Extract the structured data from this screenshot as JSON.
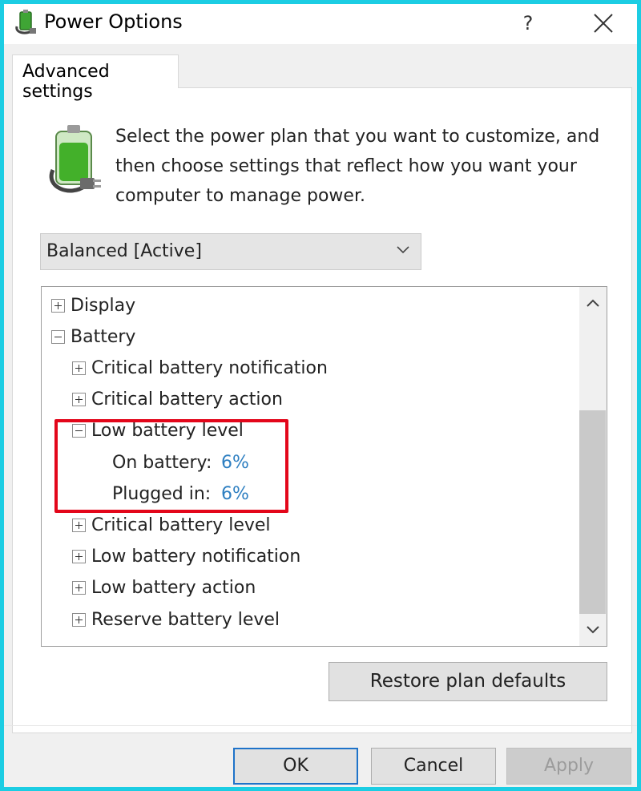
{
  "window": {
    "title": "Power Options",
    "help_label": "?",
    "icon": "power-options-icon"
  },
  "tabs": [
    {
      "label": "Advanced settings"
    }
  ],
  "description": {
    "lines": [
      "Select the power plan that you want to customize, and",
      "then choose settings that reflect how you want your",
      "computer to manage power."
    ],
    "icon": "battery-plug-icon"
  },
  "plan_select": {
    "value": "Balanced [Active]"
  },
  "tree": {
    "items": [
      {
        "label": "Display",
        "state": "collapsed"
      },
      {
        "label": "Battery",
        "state": "expanded"
      },
      {
        "label": "Critical battery notification",
        "state": "collapsed"
      },
      {
        "label": "Critical battery action",
        "state": "collapsed"
      },
      {
        "label": "Low battery level",
        "state": "expanded"
      },
      {
        "label": "On battery:",
        "value": "6%"
      },
      {
        "label": "Plugged in:",
        "value": "6%"
      },
      {
        "label": "Critical battery level",
        "state": "collapsed"
      },
      {
        "label": "Low battery notification",
        "state": "collapsed"
      },
      {
        "label": "Low battery action",
        "state": "collapsed"
      },
      {
        "label": "Reserve battery level",
        "state": "collapsed"
      }
    ]
  },
  "buttons": {
    "restore": "Restore plan defaults",
    "ok": "OK",
    "cancel": "Cancel",
    "apply": "Apply"
  },
  "colors": {
    "window_border": "#1ccde3",
    "highlight": "#e3061a",
    "value_link": "#2e7fc1",
    "default_button_border": "#1e73c9"
  }
}
